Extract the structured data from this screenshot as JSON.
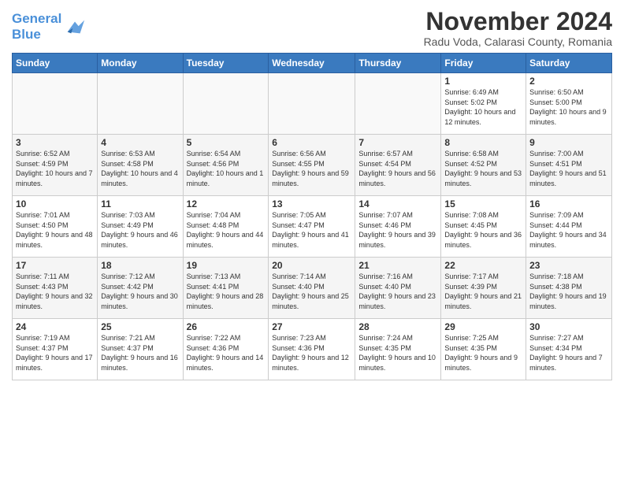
{
  "logo": {
    "line1": "General",
    "line2": "Blue"
  },
  "title": "November 2024",
  "location": "Radu Voda, Calarasi County, Romania",
  "headers": [
    "Sunday",
    "Monday",
    "Tuesday",
    "Wednesday",
    "Thursday",
    "Friday",
    "Saturday"
  ],
  "rows": [
    [
      {
        "day": "",
        "info": ""
      },
      {
        "day": "",
        "info": ""
      },
      {
        "day": "",
        "info": ""
      },
      {
        "day": "",
        "info": ""
      },
      {
        "day": "",
        "info": ""
      },
      {
        "day": "1",
        "info": "Sunrise: 6:49 AM\nSunset: 5:02 PM\nDaylight: 10 hours and 12 minutes."
      },
      {
        "day": "2",
        "info": "Sunrise: 6:50 AM\nSunset: 5:00 PM\nDaylight: 10 hours and 9 minutes."
      }
    ],
    [
      {
        "day": "3",
        "info": "Sunrise: 6:52 AM\nSunset: 4:59 PM\nDaylight: 10 hours and 7 minutes."
      },
      {
        "day": "4",
        "info": "Sunrise: 6:53 AM\nSunset: 4:58 PM\nDaylight: 10 hours and 4 minutes."
      },
      {
        "day": "5",
        "info": "Sunrise: 6:54 AM\nSunset: 4:56 PM\nDaylight: 10 hours and 1 minute."
      },
      {
        "day": "6",
        "info": "Sunrise: 6:56 AM\nSunset: 4:55 PM\nDaylight: 9 hours and 59 minutes."
      },
      {
        "day": "7",
        "info": "Sunrise: 6:57 AM\nSunset: 4:54 PM\nDaylight: 9 hours and 56 minutes."
      },
      {
        "day": "8",
        "info": "Sunrise: 6:58 AM\nSunset: 4:52 PM\nDaylight: 9 hours and 53 minutes."
      },
      {
        "day": "9",
        "info": "Sunrise: 7:00 AM\nSunset: 4:51 PM\nDaylight: 9 hours and 51 minutes."
      }
    ],
    [
      {
        "day": "10",
        "info": "Sunrise: 7:01 AM\nSunset: 4:50 PM\nDaylight: 9 hours and 48 minutes."
      },
      {
        "day": "11",
        "info": "Sunrise: 7:03 AM\nSunset: 4:49 PM\nDaylight: 9 hours and 46 minutes."
      },
      {
        "day": "12",
        "info": "Sunrise: 7:04 AM\nSunset: 4:48 PM\nDaylight: 9 hours and 44 minutes."
      },
      {
        "day": "13",
        "info": "Sunrise: 7:05 AM\nSunset: 4:47 PM\nDaylight: 9 hours and 41 minutes."
      },
      {
        "day": "14",
        "info": "Sunrise: 7:07 AM\nSunset: 4:46 PM\nDaylight: 9 hours and 39 minutes."
      },
      {
        "day": "15",
        "info": "Sunrise: 7:08 AM\nSunset: 4:45 PM\nDaylight: 9 hours and 36 minutes."
      },
      {
        "day": "16",
        "info": "Sunrise: 7:09 AM\nSunset: 4:44 PM\nDaylight: 9 hours and 34 minutes."
      }
    ],
    [
      {
        "day": "17",
        "info": "Sunrise: 7:11 AM\nSunset: 4:43 PM\nDaylight: 9 hours and 32 minutes."
      },
      {
        "day": "18",
        "info": "Sunrise: 7:12 AM\nSunset: 4:42 PM\nDaylight: 9 hours and 30 minutes."
      },
      {
        "day": "19",
        "info": "Sunrise: 7:13 AM\nSunset: 4:41 PM\nDaylight: 9 hours and 28 minutes."
      },
      {
        "day": "20",
        "info": "Sunrise: 7:14 AM\nSunset: 4:40 PM\nDaylight: 9 hours and 25 minutes."
      },
      {
        "day": "21",
        "info": "Sunrise: 7:16 AM\nSunset: 4:40 PM\nDaylight: 9 hours and 23 minutes."
      },
      {
        "day": "22",
        "info": "Sunrise: 7:17 AM\nSunset: 4:39 PM\nDaylight: 9 hours and 21 minutes."
      },
      {
        "day": "23",
        "info": "Sunrise: 7:18 AM\nSunset: 4:38 PM\nDaylight: 9 hours and 19 minutes."
      }
    ],
    [
      {
        "day": "24",
        "info": "Sunrise: 7:19 AM\nSunset: 4:37 PM\nDaylight: 9 hours and 17 minutes."
      },
      {
        "day": "25",
        "info": "Sunrise: 7:21 AM\nSunset: 4:37 PM\nDaylight: 9 hours and 16 minutes."
      },
      {
        "day": "26",
        "info": "Sunrise: 7:22 AM\nSunset: 4:36 PM\nDaylight: 9 hours and 14 minutes."
      },
      {
        "day": "27",
        "info": "Sunrise: 7:23 AM\nSunset: 4:36 PM\nDaylight: 9 hours and 12 minutes."
      },
      {
        "day": "28",
        "info": "Sunrise: 7:24 AM\nSunset: 4:35 PM\nDaylight: 9 hours and 10 minutes."
      },
      {
        "day": "29",
        "info": "Sunrise: 7:25 AM\nSunset: 4:35 PM\nDaylight: 9 hours and 9 minutes."
      },
      {
        "day": "30",
        "info": "Sunrise: 7:27 AM\nSunset: 4:34 PM\nDaylight: 9 hours and 7 minutes."
      }
    ]
  ]
}
